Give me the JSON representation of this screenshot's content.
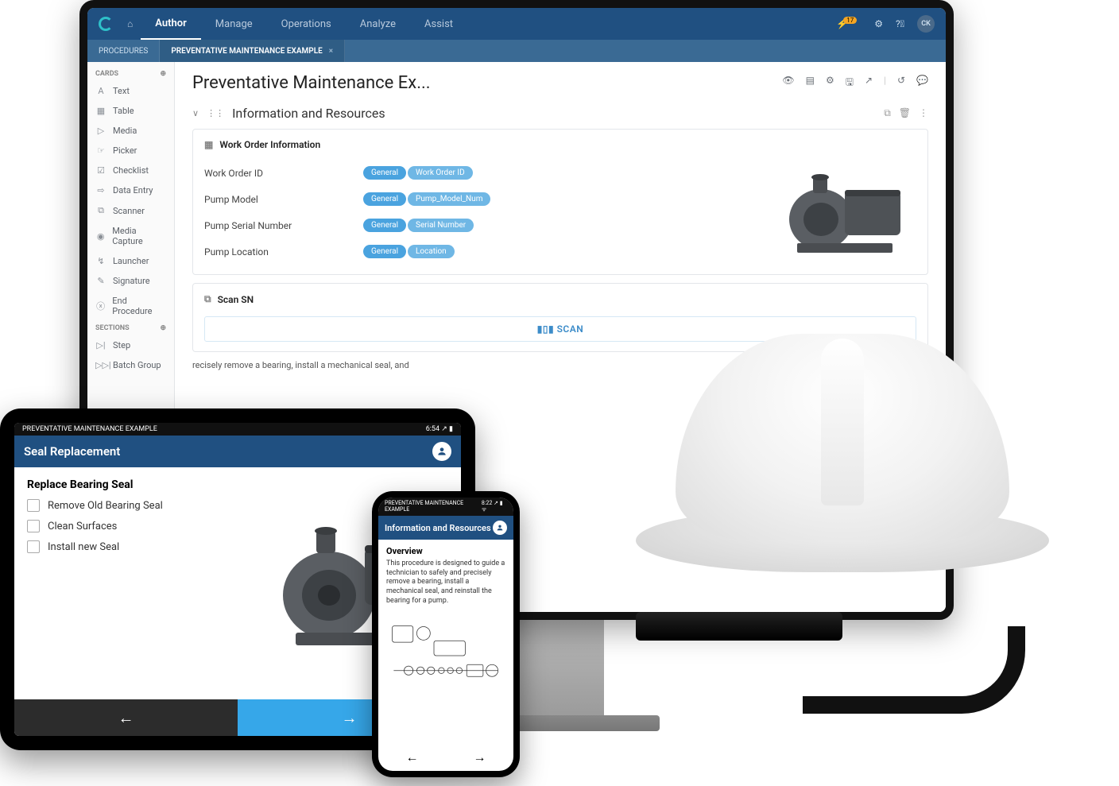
{
  "topnav": {
    "items": [
      "Author",
      "Manage",
      "Operations",
      "Analyze",
      "Assist"
    ],
    "active": "Author",
    "notif_count": "17",
    "avatar": "CK"
  },
  "tabstrip": {
    "root": "PROCEDURES",
    "open": "PREVENTATIVE MAINTENANCE EXAMPLE"
  },
  "sidebar": {
    "cards_header": "CARDS",
    "cards": [
      {
        "icon": "A",
        "label": "Text"
      },
      {
        "icon": "▦",
        "label": "Table"
      },
      {
        "icon": "▷",
        "label": "Media"
      },
      {
        "icon": "☞",
        "label": "Picker"
      },
      {
        "icon": "☑",
        "label": "Checklist"
      },
      {
        "icon": "⇨",
        "label": "Data Entry"
      },
      {
        "icon": "⧉",
        "label": "Scanner"
      },
      {
        "icon": "◉",
        "label": "Media Capture"
      },
      {
        "icon": "↯",
        "label": "Launcher"
      },
      {
        "icon": "✎",
        "label": "Signature"
      },
      {
        "icon": "ⓧ",
        "label": "End Procedure"
      }
    ],
    "sections_header": "SECTIONS",
    "sections": [
      {
        "icon": "▷|",
        "label": "Step"
      },
      {
        "icon": "▷▷|",
        "label": "Batch Group"
      }
    ]
  },
  "main": {
    "title": "Preventative Maintenance Ex...",
    "section_title": "Information and Resources",
    "work_order": {
      "card_title": "Work Order Information",
      "rows": [
        {
          "label": "Work Order ID",
          "g": "General",
          "v": "Work Order ID"
        },
        {
          "label": "Pump Model",
          "g": "General",
          "v": "Pump_Model_Num"
        },
        {
          "label": "Pump Serial Number",
          "g": "General",
          "v": "Serial Number"
        },
        {
          "label": "Pump Location",
          "g": "General",
          "v": "Location"
        }
      ]
    },
    "scan": {
      "title": "Scan SN",
      "button": "SCAN"
    },
    "overview_fragment": "recisely remove a bearing, install a mechanical seal, and"
  },
  "tablet": {
    "status_left": "PREVENTATIVE MAINTENANCE EXAMPLE",
    "status_right": "6:54 ↗ ▮",
    "header": "Seal Replacement",
    "subhead": "Replace Bearing Seal",
    "checks": [
      "Remove Old Bearing Seal",
      "Clean Surfaces",
      "Install new Seal"
    ]
  },
  "phone": {
    "status_left": "PREVENTATIVE MAINTENANCE EXAMPLE",
    "status_right": "8:22 ↗ ▮ ᯤ",
    "header": "Information and Resources",
    "overview_title": "Overview",
    "overview_body": "This procedure is designed to guide a technician to safely and precisely remove a bearing, install a mechanical seal, and reinstall the bearing for a pump."
  }
}
